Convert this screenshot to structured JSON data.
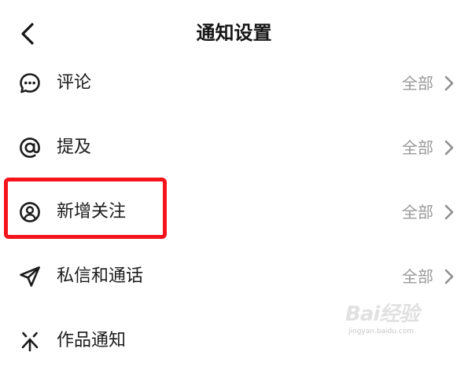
{
  "header": {
    "title": "通知设置",
    "back_icon": "chevron-left-icon"
  },
  "settings": {
    "items": [
      {
        "label": "评论",
        "value": "全部",
        "icon": "comment-bubble-icon"
      },
      {
        "label": "提及",
        "value": "全部",
        "icon": "at-sign-icon"
      },
      {
        "label": "新增关注",
        "value": "全部",
        "icon": "user-circle-icon"
      },
      {
        "label": "私信和通话",
        "value": "全部",
        "icon": "paper-plane-icon"
      },
      {
        "label": "作品通知",
        "value": "",
        "icon": "sparkle-icon"
      }
    ]
  },
  "highlight": {
    "color": "#f5141b",
    "target": "新增关注"
  },
  "watermark": {
    "logo": "Bai经验",
    "url": "jingyan.baidu.com"
  },
  "colors": {
    "text": "#1c1c1c",
    "value_text": "#9a9a9a",
    "background": "#ffffff"
  }
}
